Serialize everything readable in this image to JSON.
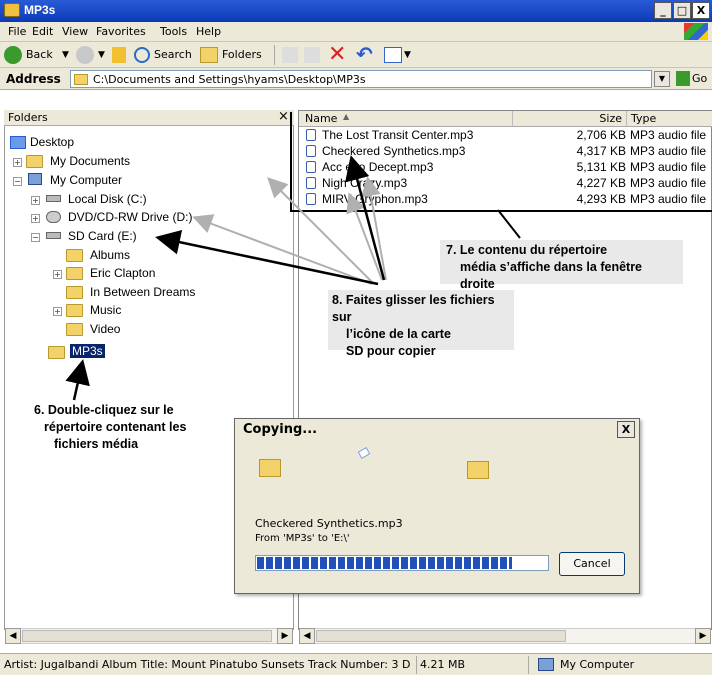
{
  "window": {
    "title": "MP3s",
    "controls": [
      "_",
      "□",
      "X"
    ]
  },
  "menu": [
    "File",
    "Edit",
    "View",
    "Favorites",
    "Tools",
    "Help"
  ],
  "toolbar": {
    "back": "Back",
    "search": "Search",
    "folders": "Folders"
  },
  "address": {
    "label": "Address",
    "path": "C:\\Documents and Settings\\hyams\\Desktop\\MP3s",
    "go": "Go"
  },
  "folders_panel": {
    "title": "Folders",
    "close": "×",
    "tree": [
      {
        "label": "Desktop"
      },
      {
        "label": "My Documents"
      },
      {
        "label": "My Computer"
      },
      {
        "label": "Local Disk (C:)"
      },
      {
        "label": "DVD/CD-RW Drive (D:)"
      },
      {
        "label": "SD Card (E:)"
      },
      {
        "label": "Albums"
      },
      {
        "label": "Eric Clapton"
      },
      {
        "label": "In Between Dreams"
      },
      {
        "label": "Music"
      },
      {
        "label": "Video"
      },
      {
        "label": "MP3s"
      }
    ]
  },
  "file_list": {
    "columns": [
      "Name",
      "Size",
      "Type"
    ],
    "rows": [
      {
        "name": "The Lost Transit Center.mp3",
        "size": "2,706 KB",
        "type": "MP3 audio file"
      },
      {
        "name": "Checkered Synthetics.mp3",
        "size": "4,317 KB",
        "type": "MP3 audio file"
      },
      {
        "name": "Acc e to Decept.mp3",
        "size": "5,131 KB",
        "type": "MP3 audio file"
      },
      {
        "name": "Nigh Crazy.mp3",
        "size": "4,227 KB",
        "type": "MP3 audio file"
      },
      {
        "name": "MIRV Gryphon.mp3",
        "size": "4,293 KB",
        "type": "MP3 audio file"
      }
    ]
  },
  "dialog": {
    "title": "Copying...",
    "close": "X",
    "file": "Checkered Synthetics.mp3",
    "from": "From 'MP3s' to 'E:\\'",
    "progress": 0.88,
    "cancel": "Cancel"
  },
  "statusbar": {
    "info": "Artist: Jugalbandi Album Title: Mount Pinatubo Sunsets Track Number: 3 D",
    "size": "4.21 MB",
    "location": "My Computer"
  },
  "annotations": {
    "step6": [
      "6. Double-cliquez sur le",
      "répertoire contenant les",
      "fichiers média"
    ],
    "step7": [
      "7. Le contenu du répertoire",
      "média s’affiche dans la fenêtre droite"
    ],
    "step8": [
      "8. Faites glisser les fichiers sur",
      "l’icône de la carte",
      "SD pour copier"
    ]
  },
  "colors": {
    "titlebar": "#0b3ab5",
    "selection": "#316ac5",
    "annotation_box": "#e9e9e9",
    "arrow_black": "#000000",
    "arrow_gray": "#b0b0b0"
  }
}
